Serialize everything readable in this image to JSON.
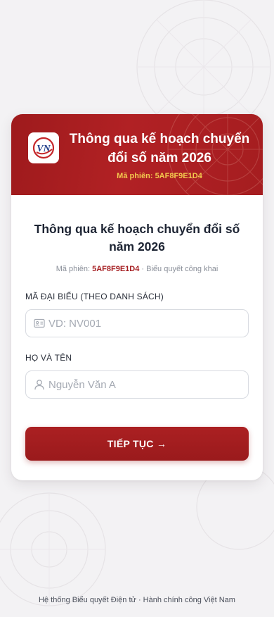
{
  "header": {
    "logo_text": "VN",
    "title": "Thông qua kế hoạch chuyển đổi số năm 2026",
    "session_label": "Mã phiên:",
    "session_code": "5AF8F9E1D4"
  },
  "main": {
    "title": "Thông qua kế hoạch chuyển đổi số năm 2026",
    "session_label": "Mã phiên:",
    "session_code": "5AF8F9E1D4",
    "vote_type": "· Biểu quyết công khai"
  },
  "form": {
    "delegate_code_label": "MÃ ĐẠI BIỂU (THEO DANH SÁCH)",
    "delegate_code_placeholder": "VD: NV001",
    "delegate_code_value": "",
    "delegate_code_icon": "id-card-icon",
    "full_name_label": "HỌ VÀ TÊN",
    "full_name_placeholder": "Nguyễn Văn A",
    "full_name_value": "",
    "full_name_icon": "user-icon",
    "submit_label": "TIẾP TỤC →"
  },
  "footer": {
    "text": "Hệ thống Biểu quyết Điện tử · Hành chính công Việt Nam"
  },
  "colors": {
    "brand_red": "#a51d20",
    "session_code_header": "#f3c94e",
    "background": "#f3f2f4"
  }
}
